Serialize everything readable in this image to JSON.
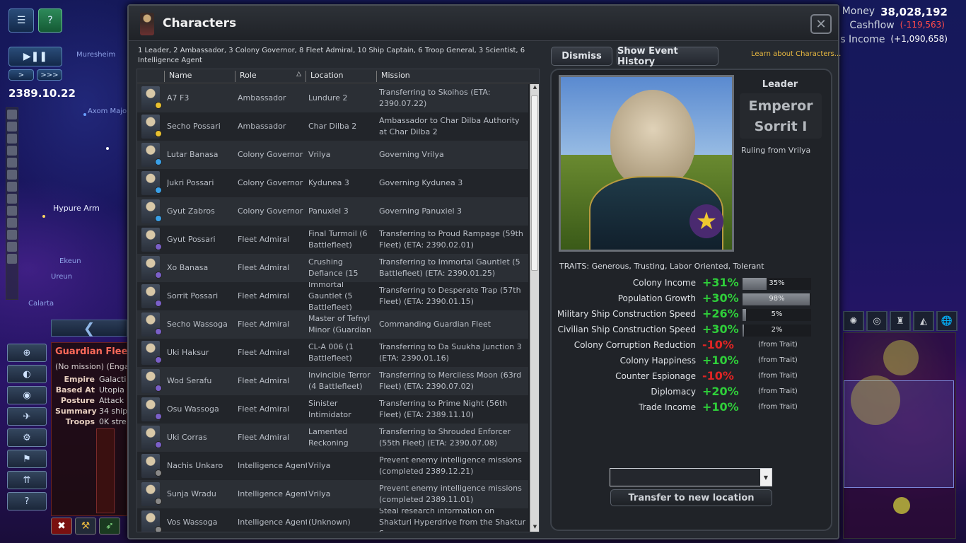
{
  "colors": {
    "positive": "#2fcf3a",
    "negative": "#e02424",
    "link": "#e8b840",
    "fleet_title": "#ff6a5a"
  },
  "hud": {
    "date": "2389.10.22",
    "speed_step": ">",
    "speed_fast": ">>>",
    "menu_icon": "menu-icon",
    "help_icon": "help-icon",
    "play_pause_icon": "play-pause-icon"
  },
  "map_labels": [
    "Hypure Arm",
    "Muresheim",
    "Axom Majo",
    "Ekeun",
    "Ureun",
    "Calarta"
  ],
  "money": {
    "money_label": "Money",
    "money_value": "38,028,192",
    "cashflow_label": "Cashflow",
    "cashflow_value": "(-119,563)",
    "income_label": "us Income",
    "income_value": "(+1,090,658)"
  },
  "fleet": {
    "collapse_icon": "chevron-left-icon",
    "title": "Guardian Flee",
    "mission": "(No mission) (Engag",
    "rows": [
      {
        "k": "Empire",
        "v": "Galacti"
      },
      {
        "k": "Based At",
        "v": "Utopia"
      },
      {
        "k": "Posture",
        "v": "Attack"
      },
      {
        "k": "Summary",
        "v": "34 ship"
      },
      {
        "k": "Troops",
        "v": "0K stre"
      }
    ],
    "side_buttons": [
      "target-lock-icon",
      "planet-icon",
      "eye-icon",
      "ship-icon",
      "gear-icon",
      "flag-icon",
      "troops-icon",
      "help-icon"
    ]
  },
  "dialog": {
    "title": "Characters",
    "close_icon": "close-icon",
    "summary": "1 Leader, 2 Ambassador, 3 Colony Governor, 8 Fleet Admiral, 10 Ship Captain, 6 Troop General, 3 Scientist, 6 Intelligence Agent",
    "columns": {
      "name": "Name",
      "role": "Role",
      "location": "Location",
      "mission": "Mission",
      "sort_indicator": "△"
    },
    "rows": [
      {
        "name": "A7 F3",
        "role": "Ambassador",
        "location": "Lundure 2",
        "mission": "Transferring to Skoihos (ETA: 2390.07.22)"
      },
      {
        "name": "Secho Possari",
        "role": "Ambassador",
        "location": "Char Dilba 2",
        "mission": "Ambassador to Char Dilba Authority at Char Dilba 2"
      },
      {
        "name": "Lutar Banasa",
        "role": "Colony Governor",
        "location": "Vrilya",
        "mission": "Governing Vrilya"
      },
      {
        "name": "Jukri Possari",
        "role": "Colony Governor",
        "location": "Kydunea 3",
        "mission": "Governing Kydunea 3"
      },
      {
        "name": "Gyut Zabros",
        "role": "Colony Governor",
        "location": "Panuxiel 3",
        "mission": "Governing Panuxiel 3"
      },
      {
        "name": "Gyut Possari",
        "role": "Fleet Admiral",
        "location": "Final Turmoil (6 Battlefleet)",
        "mission": "Transferring to Proud Rampage (59th Fleet) (ETA: 2390.02.01)"
      },
      {
        "name": "Xo Banasa",
        "role": "Fleet Admiral",
        "location": "Crushing Defiance (15",
        "mission": "Transferring to Immortal Gauntlet (5 Battlefleet) (ETA: 2390.01.25)"
      },
      {
        "name": "Sorrit Possari",
        "role": "Fleet Admiral",
        "location": "Immortal Gauntlet (5 Battlefleet)",
        "mission": "Transferring to Desperate Trap (57th Fleet) (ETA: 2390.01.15)"
      },
      {
        "name": "Secho Wassoga",
        "role": "Fleet Admiral",
        "location": "Master of Tefnyl Minor (Guardian",
        "mission": "Commanding Guardian Fleet"
      },
      {
        "name": "Uki Haksur",
        "role": "Fleet Admiral",
        "location": "CL-A 006 (1 Battlefleet)",
        "mission": "Transferring to Da Suukha Junction 3 (ETA: 2390.01.16)"
      },
      {
        "name": "Wod Serafu",
        "role": "Fleet Admiral",
        "location": "Invincible Terror (4 Battlefleet)",
        "mission": "Transferring to Merciless Moon (63rd Fleet) (ETA: 2390.07.02)"
      },
      {
        "name": "Osu Wassoga",
        "role": "Fleet Admiral",
        "location": "Sinister Intimidator",
        "mission": "Transferring to Prime Night (56th Fleet) (ETA: 2389.11.10)"
      },
      {
        "name": "Uki Corras",
        "role": "Fleet Admiral",
        "location": "Lamented Reckoning",
        "mission": "Transferring to Shrouded Enforcer (55th Fleet) (ETA: 2390.07.08)"
      },
      {
        "name": "Nachis Unkaro",
        "role": "Intelligence Agent",
        "location": "Vrilya",
        "mission": "Prevent enemy intelligence missions (completed 2389.12.21)"
      },
      {
        "name": "Sunja Wradu",
        "role": "Intelligence Agent",
        "location": "Vrilya",
        "mission": "Prevent enemy intelligence missions (completed 2389.11.01)"
      },
      {
        "name": "Vos Wassoga",
        "role": "Intelligence Agent",
        "location": "(Unknown)",
        "mission": "Steal research information on Shakturi Hyperdrive from the Shaktur Supremacy"
      }
    ],
    "badge_colors": [
      "#e8c030",
      "#e8c030",
      "#3aa0e8",
      "#3aa0e8",
      "#3aa0e8",
      "#7a60c8",
      "#7a60c8",
      "#7a60c8",
      "#7a60c8",
      "#7a60c8",
      "#7a60c8",
      "#7a60c8",
      "#7a60c8",
      "#888888",
      "#888888",
      "#888888"
    ],
    "scroll_up_icon": "▲",
    "scroll_down_icon": "▼"
  },
  "detail": {
    "dismiss_label": "Dismiss",
    "history_label": "Show Event History",
    "learn_link": "Learn about Characters...",
    "leader_label": "Leader",
    "leader_name": "Emperor Sorrit I",
    "ruling": "Ruling from Vrilya",
    "rank_icon": "gold-star-icon",
    "traits": "TRAITS: Generous, Trusting, Labor Oriented, Tolerant",
    "effects": [
      {
        "name": "Colony Income",
        "value": "+31%",
        "sign": "pos",
        "bar_pct": 35,
        "bar_label": "35%"
      },
      {
        "name": "Population Growth",
        "value": "+30%",
        "sign": "pos",
        "bar_pct": 98,
        "bar_label": "98%"
      },
      {
        "name": "Military Ship Construction Speed",
        "value": "+26%",
        "sign": "pos",
        "bar_pct": 5,
        "bar_label": "5%"
      },
      {
        "name": "Civilian Ship Construction Speed",
        "value": "+30%",
        "sign": "pos",
        "bar_pct": 2,
        "bar_label": "2%"
      },
      {
        "name": "Colony Corruption Reduction",
        "value": "-10%",
        "sign": "neg",
        "note": "(from Trait)"
      },
      {
        "name": "Colony Happiness",
        "value": "+10%",
        "sign": "pos",
        "note": "(from Trait)"
      },
      {
        "name": "Counter Espionage",
        "value": "-10%",
        "sign": "neg",
        "note": "(from Trait)"
      },
      {
        "name": "Diplomacy",
        "value": "+20%",
        "sign": "pos",
        "note": "(from Trait)"
      },
      {
        "name": "Trade Income",
        "value": "+10%",
        "sign": "pos",
        "note": "(from Trait)"
      }
    ],
    "location_select_value": "",
    "transfer_label": "Transfer to new location"
  }
}
